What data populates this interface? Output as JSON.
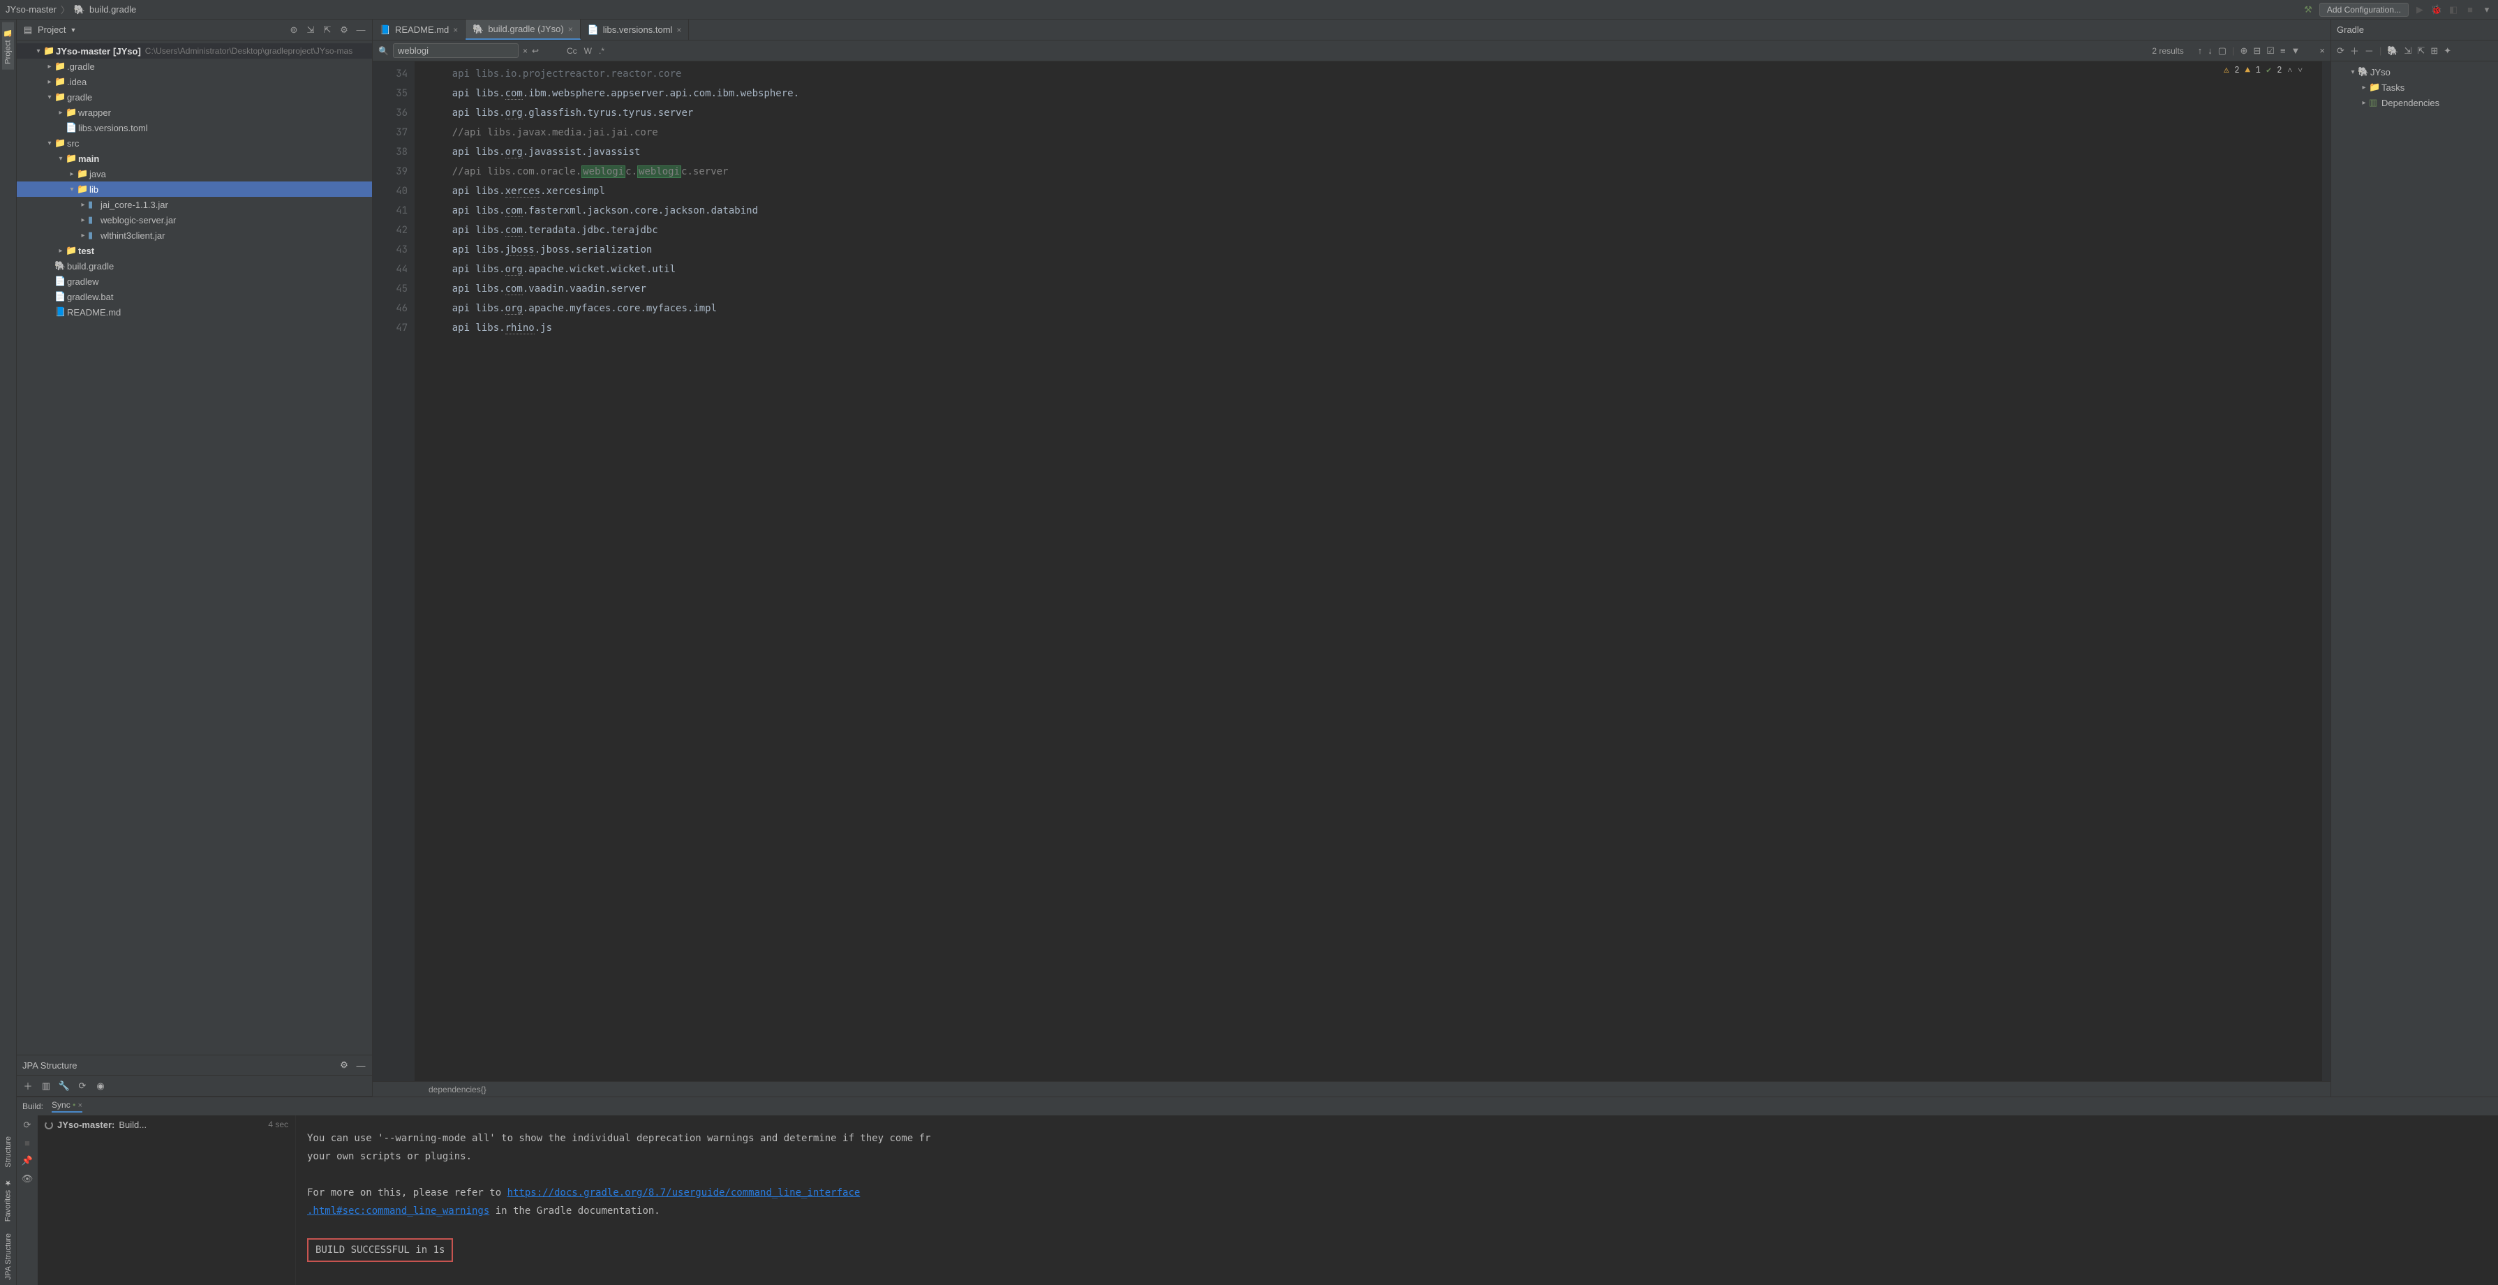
{
  "nav": {
    "breadcrumb_root": "JYso-master",
    "breadcrumb_file": "build.gradle",
    "add_config": "Add Configuration..."
  },
  "left_tabs": {
    "project": "Project",
    "structure": "Structure",
    "favorites": "Favorites",
    "jpa": "JPA Structure"
  },
  "project_panel": {
    "title": "Project",
    "root": "JYso-master",
    "root_suffix": "[JYso]",
    "root_path": "C:\\Users\\Administrator\\Desktop\\gradleproject\\JYso-mas",
    "items": {
      "gradle_dot": ".gradle",
      "idea": ".idea",
      "gradle": "gradle",
      "wrapper": "wrapper",
      "libs_versions": "libs.versions.toml",
      "src": "src",
      "main": "main",
      "java": "java",
      "lib": "lib",
      "jai_core": "jai_core-1.1.3.jar",
      "weblogic": "weblogic-server.jar",
      "wlthint3": "wlthint3client.jar",
      "test": "test",
      "build_gradle": "build.gradle",
      "gradlew": "gradlew",
      "gradlew_bat": "gradlew.bat",
      "readme": "README.md"
    }
  },
  "jpa": {
    "title": "JPA Structure"
  },
  "tabs": {
    "readme": "README.md",
    "build": "build.gradle (JYso)",
    "libs": "libs.versions.toml"
  },
  "search": {
    "query": "weblogi",
    "results": "2 results",
    "cc": "Cc",
    "w": "W"
  },
  "inspections": {
    "warn": "2",
    "err": "1",
    "ok": "2"
  },
  "code": {
    "lines": [
      "34",
      "35",
      "36",
      "37",
      "38",
      "39",
      "40",
      "41",
      "42",
      "43",
      "44",
      "45",
      "46",
      "47"
    ],
    "l34": "    api libs.io.projectreactor.reactor.core",
    "l35a": "    api libs.",
    "l35b": "com",
    "l35c": ".ibm.websphere.appserver.api.com.ibm.websphere.",
    "l36a": "    api libs.",
    "l36b": "org",
    "l36c": ".glassfish.tyrus.tyrus.server",
    "l37": "    //api libs.javax.media.jai.jai.core",
    "l38a": "    api libs.",
    "l38b": "org",
    "l38c": ".javassist.javassist",
    "l39a": "    //api libs.com.oracle.",
    "l39m1": "weblogi",
    "l39b": "c.",
    "l39m2": "weblogi",
    "l39c": "c.server",
    "l40a": "    api libs.",
    "l40b": "xerces",
    "l40c": ".xercesimpl",
    "l41a": "    api libs.",
    "l41b": "com",
    "l41c": ".fasterxml.jackson.core.jackson.databind",
    "l42a": "    api libs.",
    "l42b": "com",
    "l42c": ".teradata.jdbc.terajdbc",
    "l43a": "    api libs.",
    "l43b": "jboss",
    "l43c": ".jboss.serialization",
    "l44a": "    api libs.",
    "l44b": "org",
    "l44c": ".apache.wicket.wicket.util",
    "l45a": "    api libs.",
    "l45b": "com",
    "l45c": ".vaadin.vaadin.server",
    "l46a": "    api libs.",
    "l46b": "org",
    "l46c": ".apache.myfaces.core.myfaces.impl",
    "l47a": "    api libs.",
    "l47b": "rhino",
    "l47c": ".js"
  },
  "breadcrumb_bottom": "dependencies{}",
  "gradle": {
    "title": "Gradle",
    "root": "JYso",
    "tasks": "Tasks",
    "deps": "Dependencies"
  },
  "build": {
    "label": "Build:",
    "tab": "Sync",
    "task_root": "JYso-master:",
    "task_text": "Build...",
    "task_time": "4 sec",
    "line1": "You can use '--warning-mode all' to show the individual deprecation warnings and determine if they come fr",
    "line2": " your own scripts or plugins.",
    "line3a": "For more on this, please refer to ",
    "link1": "https://docs.gradle.org/8.7/userguide/command_line_interface",
    "link2": ".html#sec:command_line_warnings",
    "line3b": " in the Gradle documentation.",
    "success": "BUILD SUCCESSFUL in 1s"
  }
}
